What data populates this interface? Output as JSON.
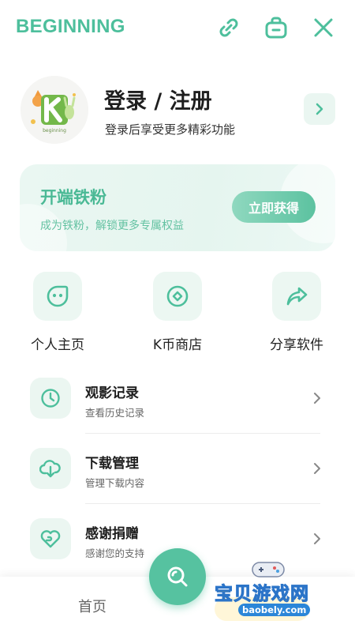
{
  "header": {
    "brand": "BEGINNING",
    "icons": [
      "link-icon",
      "bag-icon",
      "close-icon"
    ]
  },
  "profile": {
    "avatar_letter": "K",
    "avatar_caption": "beginning",
    "title": "登录 / 注册",
    "subtitle": "登录后享受更多精彩功能"
  },
  "fan_card": {
    "title": "开端铁粉",
    "subtitle": "成为铁粉，解锁更多专属权益",
    "button": "立即获得"
  },
  "quick_actions": [
    {
      "label": "个人主页",
      "icon": "smiley-icon"
    },
    {
      "label": "K币商店",
      "icon": "coin-icon"
    },
    {
      "label": "分享软件",
      "icon": "share-icon"
    }
  ],
  "menu": [
    {
      "title": "观影记录",
      "subtitle": "查看历史记录",
      "icon": "clock-icon"
    },
    {
      "title": "下载管理",
      "subtitle": "管理下载内容",
      "icon": "cloud-download-icon"
    },
    {
      "title": "感谢捐赠",
      "subtitle": "感谢您的支持",
      "icon": "heart-hand-icon"
    }
  ],
  "bottom_nav": {
    "home": "首页",
    "search_icon": "search-icon"
  },
  "watermark": {
    "text": "宝贝游戏网",
    "url": "baobely.com"
  },
  "colors": {
    "accent": "#4dbf9c",
    "accent_light": "#ebf6f1",
    "fab": "#56c2a0"
  }
}
